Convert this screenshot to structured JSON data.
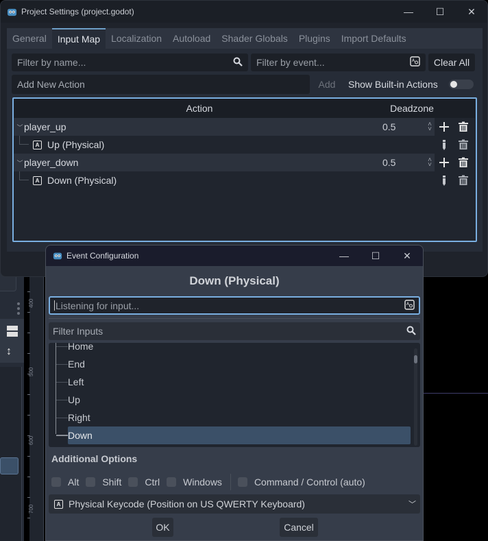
{
  "background_editor": {
    "ruler_labels": [
      "400",
      "500",
      "600",
      "700"
    ]
  },
  "project_settings": {
    "title": "Project Settings (project.godot)",
    "window_controls": {
      "minimize": "—",
      "maximize": "☐",
      "close": "✕"
    },
    "tabs": [
      {
        "label": "General",
        "active": false
      },
      {
        "label": "Input Map",
        "active": true
      },
      {
        "label": "Localization",
        "active": false
      },
      {
        "label": "Autoload",
        "active": false
      },
      {
        "label": "Shader Globals",
        "active": false
      },
      {
        "label": "Plugins",
        "active": false
      },
      {
        "label": "Import Defaults",
        "active": false
      }
    ],
    "filter_name": {
      "placeholder": "Filter by name...",
      "icon": "search-icon"
    },
    "filter_event": {
      "placeholder": "Filter by event...",
      "icon": "keyboard-icon"
    },
    "clear_all_label": "Clear All",
    "add_action": {
      "placeholder": "Add New Action",
      "add_label": "Add"
    },
    "show_builtin": {
      "label": "Show Built-in Actions",
      "enabled": false
    },
    "tree": {
      "headers": {
        "action": "Action",
        "deadzone": "Deadzone"
      },
      "actions": [
        {
          "name": "player_up",
          "deadzone": "0.5",
          "events": [
            {
              "label": "Up (Physical)"
            }
          ]
        },
        {
          "name": "player_down",
          "deadzone": "0.5",
          "events": [
            {
              "label": "Down (Physical)"
            }
          ]
        }
      ]
    }
  },
  "event_config": {
    "title": "Event Configuration",
    "window_controls": {
      "minimize": "—",
      "maximize": "☐",
      "close": "✕"
    },
    "heading": "Down (Physical)",
    "listen_field": {
      "placeholder": "Listening for input..."
    },
    "filter_inputs": {
      "placeholder": "Filter Inputs"
    },
    "input_list": [
      "Home",
      "End",
      "Left",
      "Up",
      "Right",
      "Down"
    ],
    "selected_input": "Down",
    "additional_options_title": "Additional Options",
    "modifiers": [
      {
        "label": "Alt",
        "checked": false
      },
      {
        "label": "Shift",
        "checked": false
      },
      {
        "label": "Ctrl",
        "checked": false
      },
      {
        "label": "Windows",
        "checked": false
      }
    ],
    "command_control": {
      "label": "Command / Control (auto)",
      "checked": false
    },
    "keycode_type": "Physical Keycode (Position on US QWERTY Keyboard)",
    "ok_label": "OK",
    "cancel_label": "Cancel"
  }
}
